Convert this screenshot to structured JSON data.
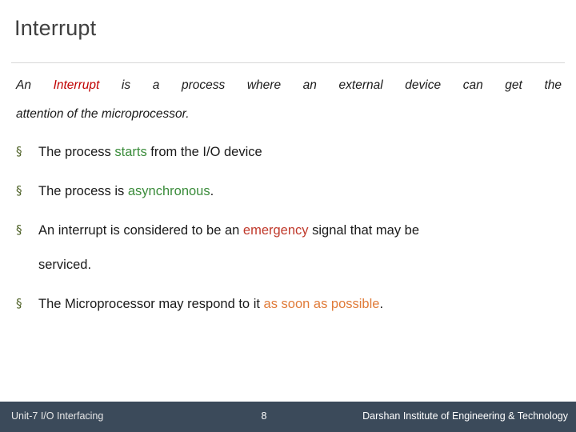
{
  "slide": {
    "title": "Interrupt",
    "lead": {
      "before": "An ",
      "keyword": "Interrupt",
      "after": " is a process where an external device can get the",
      "line2": "attention of the microprocessor."
    },
    "bullets": [
      {
        "marker": "§",
        "parts": [
          {
            "text": "The process ",
            "style": "plain"
          },
          {
            "text": "starts",
            "style": "green"
          },
          {
            "text": " from the I/O device",
            "style": "plain"
          }
        ]
      },
      {
        "marker": "§",
        "parts": [
          {
            "text": "The process is ",
            "style": "plain"
          },
          {
            "text": "asynchronous",
            "style": "green"
          },
          {
            "text": ".",
            "style": "plain"
          }
        ]
      },
      {
        "marker": "§",
        "parts": [
          {
            "text": "An interrupt is considered to be an ",
            "style": "plain"
          },
          {
            "text": "emergency",
            "style": "red"
          },
          {
            "text": " signal that may be",
            "style": "plain"
          }
        ],
        "continuation": "serviced."
      },
      {
        "marker": "§",
        "parts": [
          {
            "text": "The Microprocessor may respond to it ",
            "style": "plain"
          },
          {
            "text": "as soon as possible",
            "style": "orange"
          },
          {
            "text": ".",
            "style": "plain"
          }
        ]
      }
    ]
  },
  "footer": {
    "unit": "Unit-7 I/O Interfacing",
    "page": "8",
    "institute": "Darshan Institute of Engineering & Technology"
  },
  "colors": {
    "title": "#404040",
    "keyword": "#c00000",
    "green": "#3b8c3b",
    "red": "#c0392b",
    "orange": "#e07b39",
    "footer_bg": "#3b4a5a",
    "bullet_marker": "#4f6228"
  }
}
